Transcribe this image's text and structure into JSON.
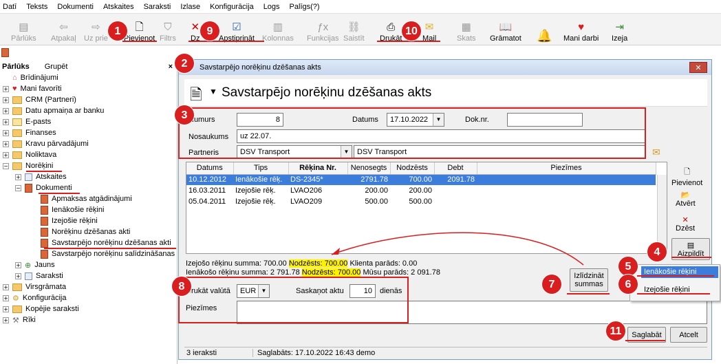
{
  "menu": [
    "Datī",
    "Teksts",
    "Dokumenti",
    "Atskaites",
    "Saraksti",
    "Izlase",
    "Konfigurācija",
    "Logs",
    "Palīgs(?)"
  ],
  "toolbar": {
    "parluks": "Pārlūks",
    "atpakal": "Atpakaļ",
    "uz_prieksu": "Uz prie",
    "pievienot": "Pievienot",
    "filtrs": "Filtrs",
    "dzest": "Dz",
    "apstiprinat": "Apstiprināt",
    "kolonnas": "Kolonnas",
    "funkcijas": "Funkcijas",
    "saistit": "Saistīt",
    "drukat": "Drukāt",
    "mail": "Mail",
    "skats": "Skats",
    "gramatot": "Grāmatot",
    "mani_darbi": "Mani darbi",
    "izeja": "Izeja"
  },
  "sidebar": {
    "tab1": "Pārlūks",
    "tab2": "Grupēt",
    "close": "×",
    "items": [
      "Brīdinājumi",
      "Mani favorīti",
      "CRM (Partneri)",
      "Datu apmaiņa ar banku",
      "E-pasts",
      "Finanses",
      "Kravu pārvadājumi",
      "Noliktava",
      "Norēķini",
      "Atskaites",
      "Dokumenti",
      "Apmaksas atgādinājumi",
      "Ienākošie rēķini",
      "Izejošie rēķini",
      "Norēķinu dzēšanas akti",
      "Savstarpējo norēķinu dzēšanas akti",
      "Savstarpējo norēķinu salīdzināšanas",
      "Jauns",
      "Saraksti",
      "Virsgrāmata",
      "Konfigurācija",
      "Kopējie saraksti",
      "Rīki"
    ]
  },
  "dialog": {
    "title": "Savstarpējo norēķinu dzēšanas akts",
    "header": "Savstarpējo norēķinu dzēšanas akts",
    "close": "✕",
    "numurs_label": "Numurs",
    "numurs": "8",
    "datums_label": "Datums",
    "datums": "17.10.2022",
    "doknr_label": "Dok.nr.",
    "doknr": "",
    "nosaukums_label": "Nosaukums",
    "nosaukums": "uz 22.07.",
    "partneris_label": "Partneris",
    "partneris": "DSV Transport",
    "partneris_name": "DSV Transport",
    "columns": [
      "Datums",
      "Tips",
      "Rēķina Nr.",
      "Nenosegts",
      "Nodzēsts",
      "Debt",
      "Piezīmes"
    ],
    "rows": [
      {
        "datums": "10.12.2012",
        "tips": "Ienākošie rēķ.",
        "nr": "DS-2345*",
        "nenosegts": "2791.78",
        "nodzests": "700.00",
        "debt": "2091.78",
        "piezimes": ""
      },
      {
        "datums": "16.03.2011",
        "tips": "Izejošie rēķ.",
        "nr": "LVAO206",
        "nenosegts": "200.00",
        "nodzests": "200.00",
        "debt": "",
        "piezimes": ""
      },
      {
        "datums": "05.04.2011",
        "tips": "Izejošie rēķ.",
        "nr": "LVAO209",
        "nenosegts": "500.00",
        "nodzests": "500.00",
        "debt": "",
        "piezimes": ""
      }
    ],
    "side_pievienot": "Pievienot",
    "side_atvert": "Atvērt",
    "side_dzest": "Dzēst",
    "side_aizpildit": "Aizpildīt",
    "sum1_a": "Izejošo rēķinu summa: 700.00 ",
    "sum1_b": "Nodzēsts: 700.00",
    "sum1_c": " Klienta parāds: 0.00",
    "sum2_a": "Ienākošo rēķinu summa: 2 791.78 ",
    "sum2_b": "Nodzēsts: 700.00",
    "sum2_c": " Mūsu parāds: 2 091.78",
    "izlidzinat": "Izlīdzināt summas",
    "druk_valuta_label": "Drukāt valūtā",
    "valuta": "EUR",
    "saskanot_label": "Saskaņot aktu",
    "saskanot": "10",
    "dienas": "dienās",
    "piezimes_label": "Piezīmes",
    "saglabat": "Saglabāt",
    "atcelt": "Atcelt",
    "status1": "3 ieraksti",
    "status2": "Saglabāts: 17.10.2022 16:43 demo"
  },
  "popup": {
    "item1": "Ienākošie rēķini",
    "item2": "Izejošie rēķini"
  },
  "badges": [
    "1",
    "2",
    "3",
    "4",
    "5",
    "6",
    "7",
    "8",
    "9",
    "10",
    "11"
  ]
}
